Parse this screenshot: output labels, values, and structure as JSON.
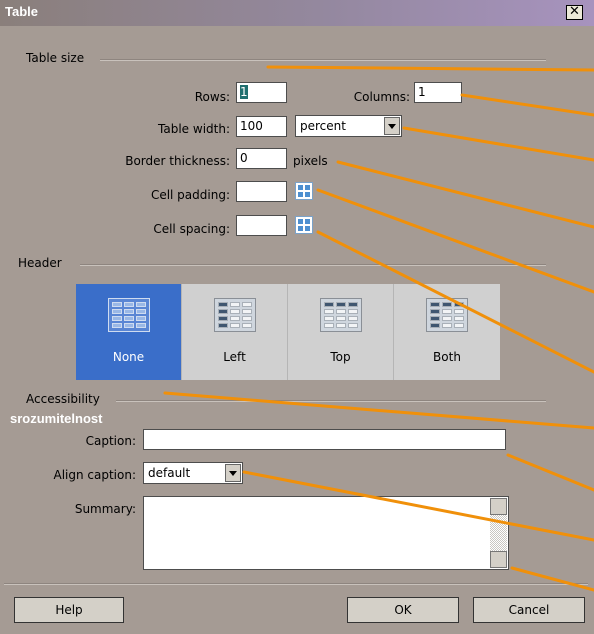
{
  "window": {
    "title": "Table",
    "close_glyph": "✕"
  },
  "table_size": {
    "heading": "Table size",
    "rows_label": "Rows:",
    "rows_value": "1",
    "columns_label": "Columns:",
    "columns_value": "1",
    "width_label": "Table width:",
    "width_value": "100",
    "width_unit": "percent",
    "border_label": "Border thickness:",
    "border_value": "0",
    "border_unit": "pixels",
    "padding_label": "Cell padding:",
    "padding_value": "",
    "spacing_label": "Cell spacing:",
    "spacing_value": ""
  },
  "header": {
    "heading": "Header",
    "options": [
      {
        "label": "None",
        "selected": true
      },
      {
        "label": "Left",
        "selected": false
      },
      {
        "label": "Top",
        "selected": false
      },
      {
        "label": "Both",
        "selected": false
      }
    ]
  },
  "accessibility": {
    "heading": "Accessibility",
    "annotation": "srozumitelnost",
    "caption_label": "Caption:",
    "caption_value": "",
    "align_label": "Align caption:",
    "align_value": "default",
    "summary_label": "Summary:",
    "summary_value": ""
  },
  "buttons": {
    "help": "Help",
    "ok": "OK",
    "cancel": "Cancel"
  },
  "colors": {
    "callout_line": "#f0900a",
    "selected_header": "#3a6ec9"
  }
}
